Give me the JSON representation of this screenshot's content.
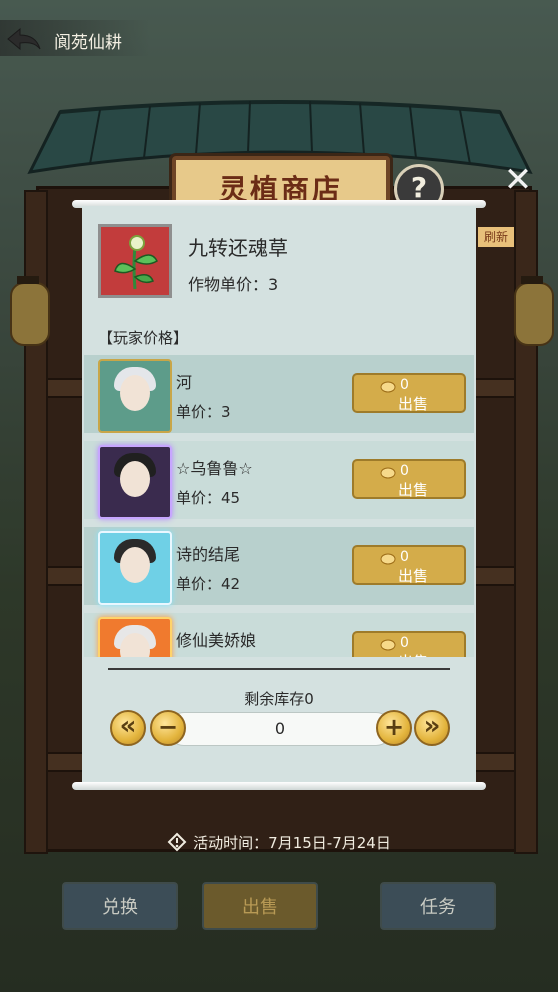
{
  "header": {
    "title": "阆苑仙耕"
  },
  "shop": {
    "title": "灵植商店",
    "help_label": "?",
    "close_label": "✕",
    "refresh_label": "刷新"
  },
  "item": {
    "name": "九转还魂草",
    "price_text": "作物单价：3"
  },
  "player_price_heading": "【玩家价格】",
  "players": [
    {
      "name": "河",
      "price_text": "单价：3",
      "sell_count": "0",
      "sell_label": "出售"
    },
    {
      "name": "☆乌鲁鲁☆",
      "price_text": "单价：45",
      "sell_count": "0",
      "sell_label": "出售"
    },
    {
      "name": "诗的结尾",
      "price_text": "单价：42",
      "sell_count": "0",
      "sell_label": "出售"
    },
    {
      "name": "修仙美娇娘",
      "price_text": "",
      "sell_count": "0",
      "sell_label": "出售"
    }
  ],
  "stock": {
    "label": "剩余库存0",
    "quantity": "0",
    "max_left_label": "«",
    "minus_label": "−",
    "plus_label": "+",
    "max_right_label": "»"
  },
  "activity": {
    "text": "活动时间：7月15日-7月24日"
  },
  "tabs": {
    "exchange": "兑换",
    "sell": "出售",
    "task": "任务"
  },
  "colors": {
    "accent_gold": "#d4ac4a",
    "panel": "#d4e1e0",
    "item_bg": "#c23c3c"
  },
  "icons": {
    "back": "back-arrow-icon",
    "coin": "coin-icon",
    "warning": "warning-icon",
    "help": "help-icon",
    "close": "close-icon"
  }
}
